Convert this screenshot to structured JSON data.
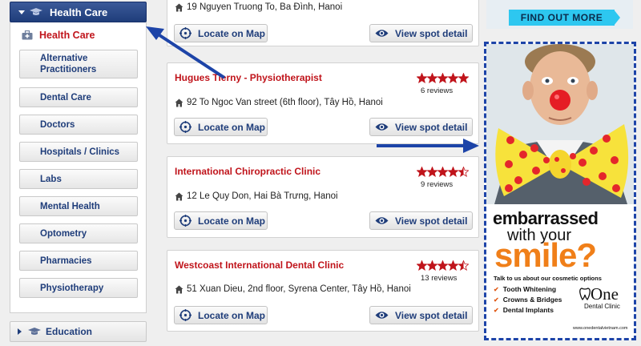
{
  "sidebar": {
    "header": "Health Care",
    "selected_item": "Health Care",
    "sub_items": [
      "Alternative Practitioners",
      "Dental Care",
      "Doctors",
      "Hospitals / Clinics",
      "Labs",
      "Mental Health",
      "Optometry",
      "Pharmacies",
      "Physiotherapy"
    ],
    "next_category": "Education"
  },
  "listings": [
    {
      "address": "19 Nguyen Truong To, Ba Đình, Hanoi",
      "locate_label": "Locate on Map",
      "view_label": "View spot detail"
    },
    {
      "name": "Hugues Tierny - Physiotherapist",
      "rating": 5,
      "reviews": "6 reviews",
      "address": "92 To Ngoc Van street (6th floor), Tây Hồ, Hanoi",
      "locate_label": "Locate on Map",
      "view_label": "View spot detail"
    },
    {
      "name": "International Chiropractic Clinic",
      "rating": 4.5,
      "reviews": "9 reviews",
      "address": "12 Le Quy Don, Hai Bà Trưng, Hanoi",
      "locate_label": "Locate on Map",
      "view_label": "View spot detail"
    },
    {
      "name": "Westcoast International Dental Clinic",
      "rating": 4.5,
      "reviews": "13 reviews",
      "address": "51 Xuan Dieu, 2nd floor, Syrena Center, Tây Hồ, Hanoi",
      "locate_label": "Locate on Map",
      "view_label": "View spot detail"
    }
  ],
  "ad_top": {
    "button": "FIND OUT MORE"
  },
  "ad": {
    "line1": "embarrassed",
    "line2": "with your",
    "line3": "smile?",
    "talk": "Talk to us about our cosmetic options",
    "services": [
      "Tooth Whitening",
      "Crowns & Bridges",
      "Dental Implants"
    ],
    "brand": "One",
    "brand_sub": "Dental Clinic",
    "url": "www.onedentalvietnam.com"
  },
  "colors": {
    "accent_red": "#c0141b",
    "nav_blue": "#1f3d7a",
    "arrow_blue": "#1d44a8",
    "ad_orange": "#f07f19"
  }
}
